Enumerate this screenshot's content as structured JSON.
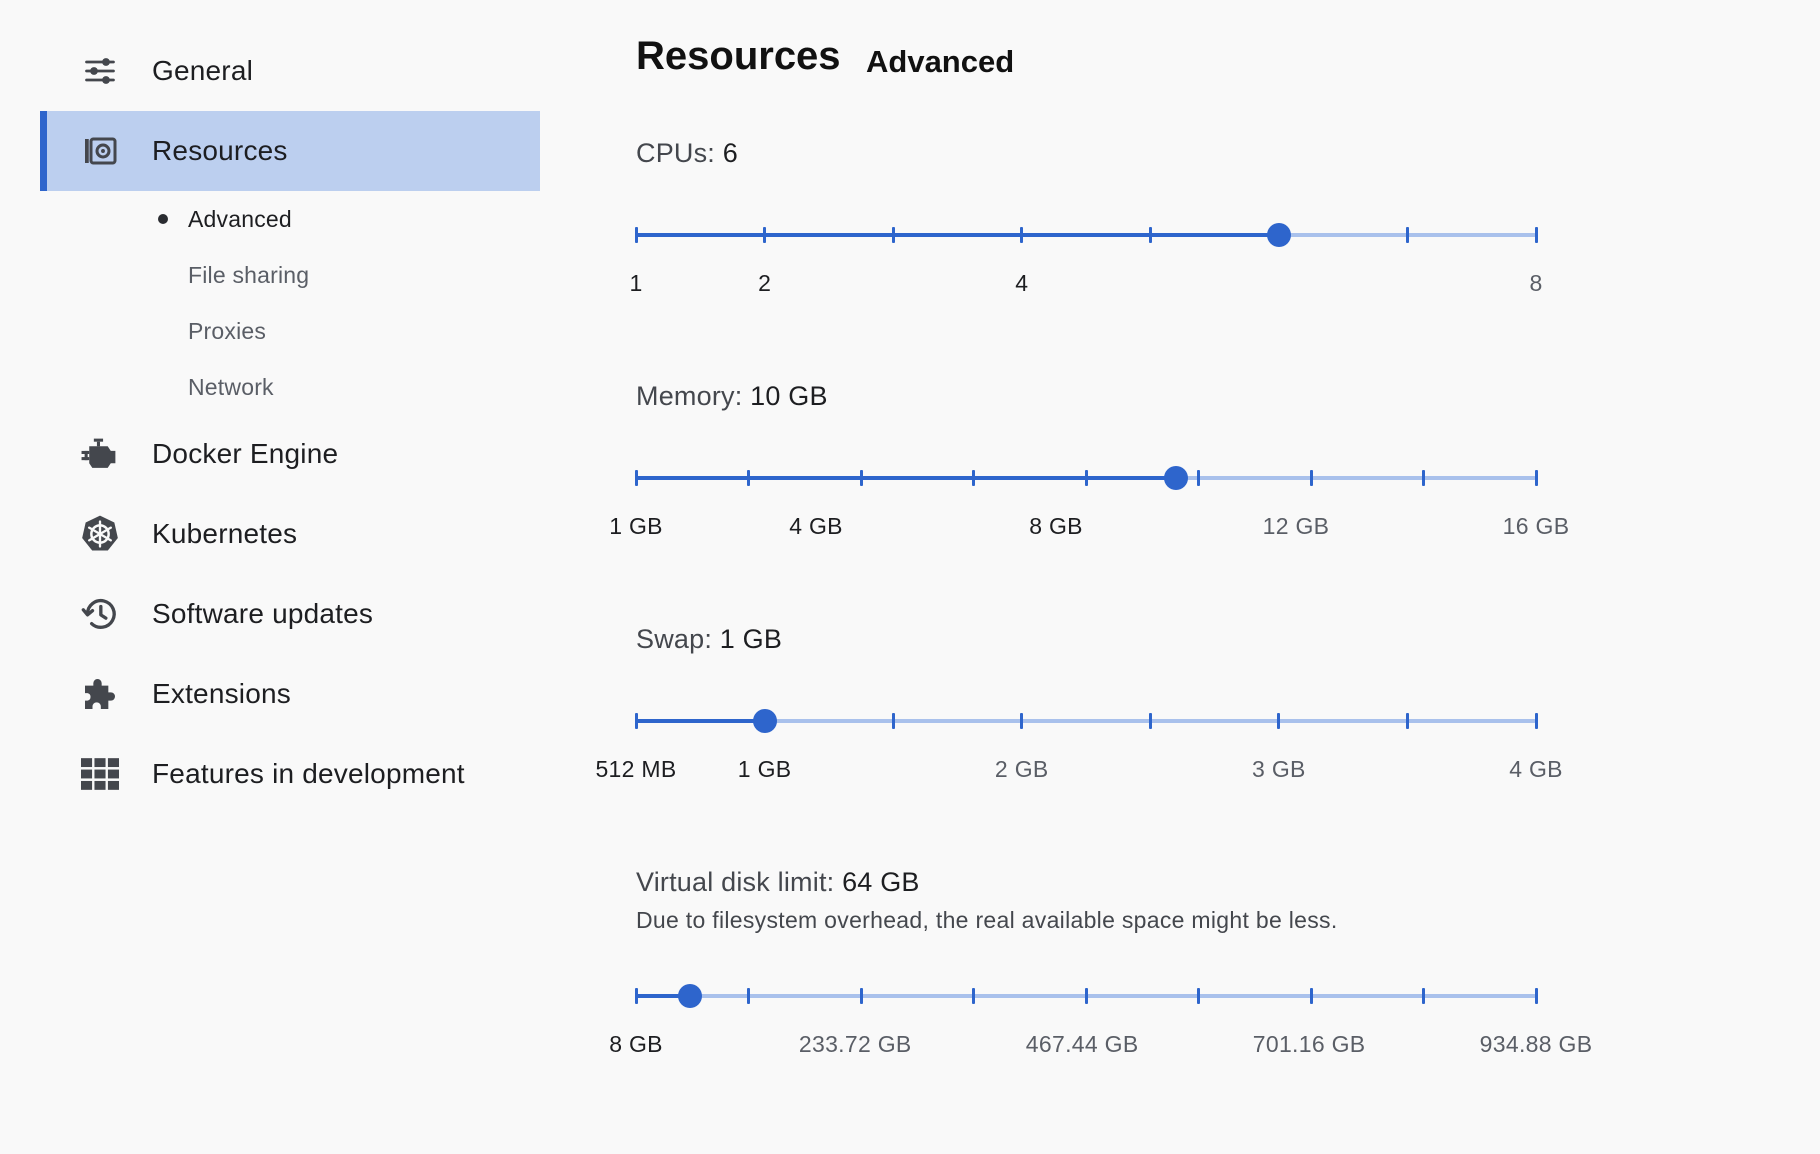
{
  "sidebar": {
    "items": [
      {
        "label": "General",
        "icon": "sliders-icon"
      },
      {
        "label": "Resources",
        "icon": "resources-icon"
      },
      {
        "label": "Docker Engine",
        "icon": "engine-icon"
      },
      {
        "label": "Kubernetes",
        "icon": "kubernetes-helm-icon"
      },
      {
        "label": "Software updates",
        "icon": "history-icon"
      },
      {
        "label": "Extensions",
        "icon": "puzzle-icon"
      },
      {
        "label": "Features in development",
        "icon": "grid-icon"
      }
    ],
    "sub_items": [
      {
        "label": "Advanced",
        "active": true
      },
      {
        "label": "File sharing",
        "active": false
      },
      {
        "label": "Proxies",
        "active": false
      },
      {
        "label": "Network",
        "active": false
      }
    ],
    "active_item": "Resources"
  },
  "header": {
    "title": "Resources",
    "subtitle": "Advanced"
  },
  "settings": {
    "cpus": {
      "label": "CPUs:",
      "value": "6",
      "tick_count": 8,
      "position": 0.7143,
      "tick_labels": [
        {
          "text": "1",
          "at": 0
        },
        {
          "text": "2",
          "at": 0.1429
        },
        {
          "text": "4",
          "at": 0.4286
        },
        {
          "text": "8",
          "at": 1
        }
      ]
    },
    "memory": {
      "label": "Memory:",
      "value": "10 GB",
      "tick_count": 9,
      "position": 0.6,
      "tick_labels": [
        {
          "text": "1 GB",
          "at": 0
        },
        {
          "text": "4 GB",
          "at": 0.2
        },
        {
          "text": "8 GB",
          "at": 0.4667
        },
        {
          "text": "12 GB",
          "at": 0.7333
        },
        {
          "text": "16 GB",
          "at": 1
        }
      ]
    },
    "swap": {
      "label": "Swap:",
      "value": "1 GB",
      "tick_count": 8,
      "position": 0.1429,
      "tick_labels": [
        {
          "text": "512 MB",
          "at": 0
        },
        {
          "text": "1 GB",
          "at": 0.1429
        },
        {
          "text": "2 GB",
          "at": 0.4286
        },
        {
          "text": "3 GB",
          "at": 0.7143
        },
        {
          "text": "4 GB",
          "at": 1
        }
      ]
    },
    "disk": {
      "label": "Virtual disk limit:",
      "value": "64 GB",
      "note": "Due to filesystem overhead, the real available space might be less.",
      "tick_count": 9,
      "position": 0.06,
      "tick_labels": [
        {
          "text": "8 GB",
          "at": 0
        },
        {
          "text": "233.72 GB",
          "at": 0.2436
        },
        {
          "text": "467.44 GB",
          "at": 0.4957
        },
        {
          "text": "701.16 GB",
          "at": 0.7479
        },
        {
          "text": "934.88 GB",
          "at": 1
        }
      ]
    }
  },
  "colors": {
    "accent": "#2e65cc",
    "track": "#a9c1ec",
    "active_bg": "#bccfef"
  }
}
